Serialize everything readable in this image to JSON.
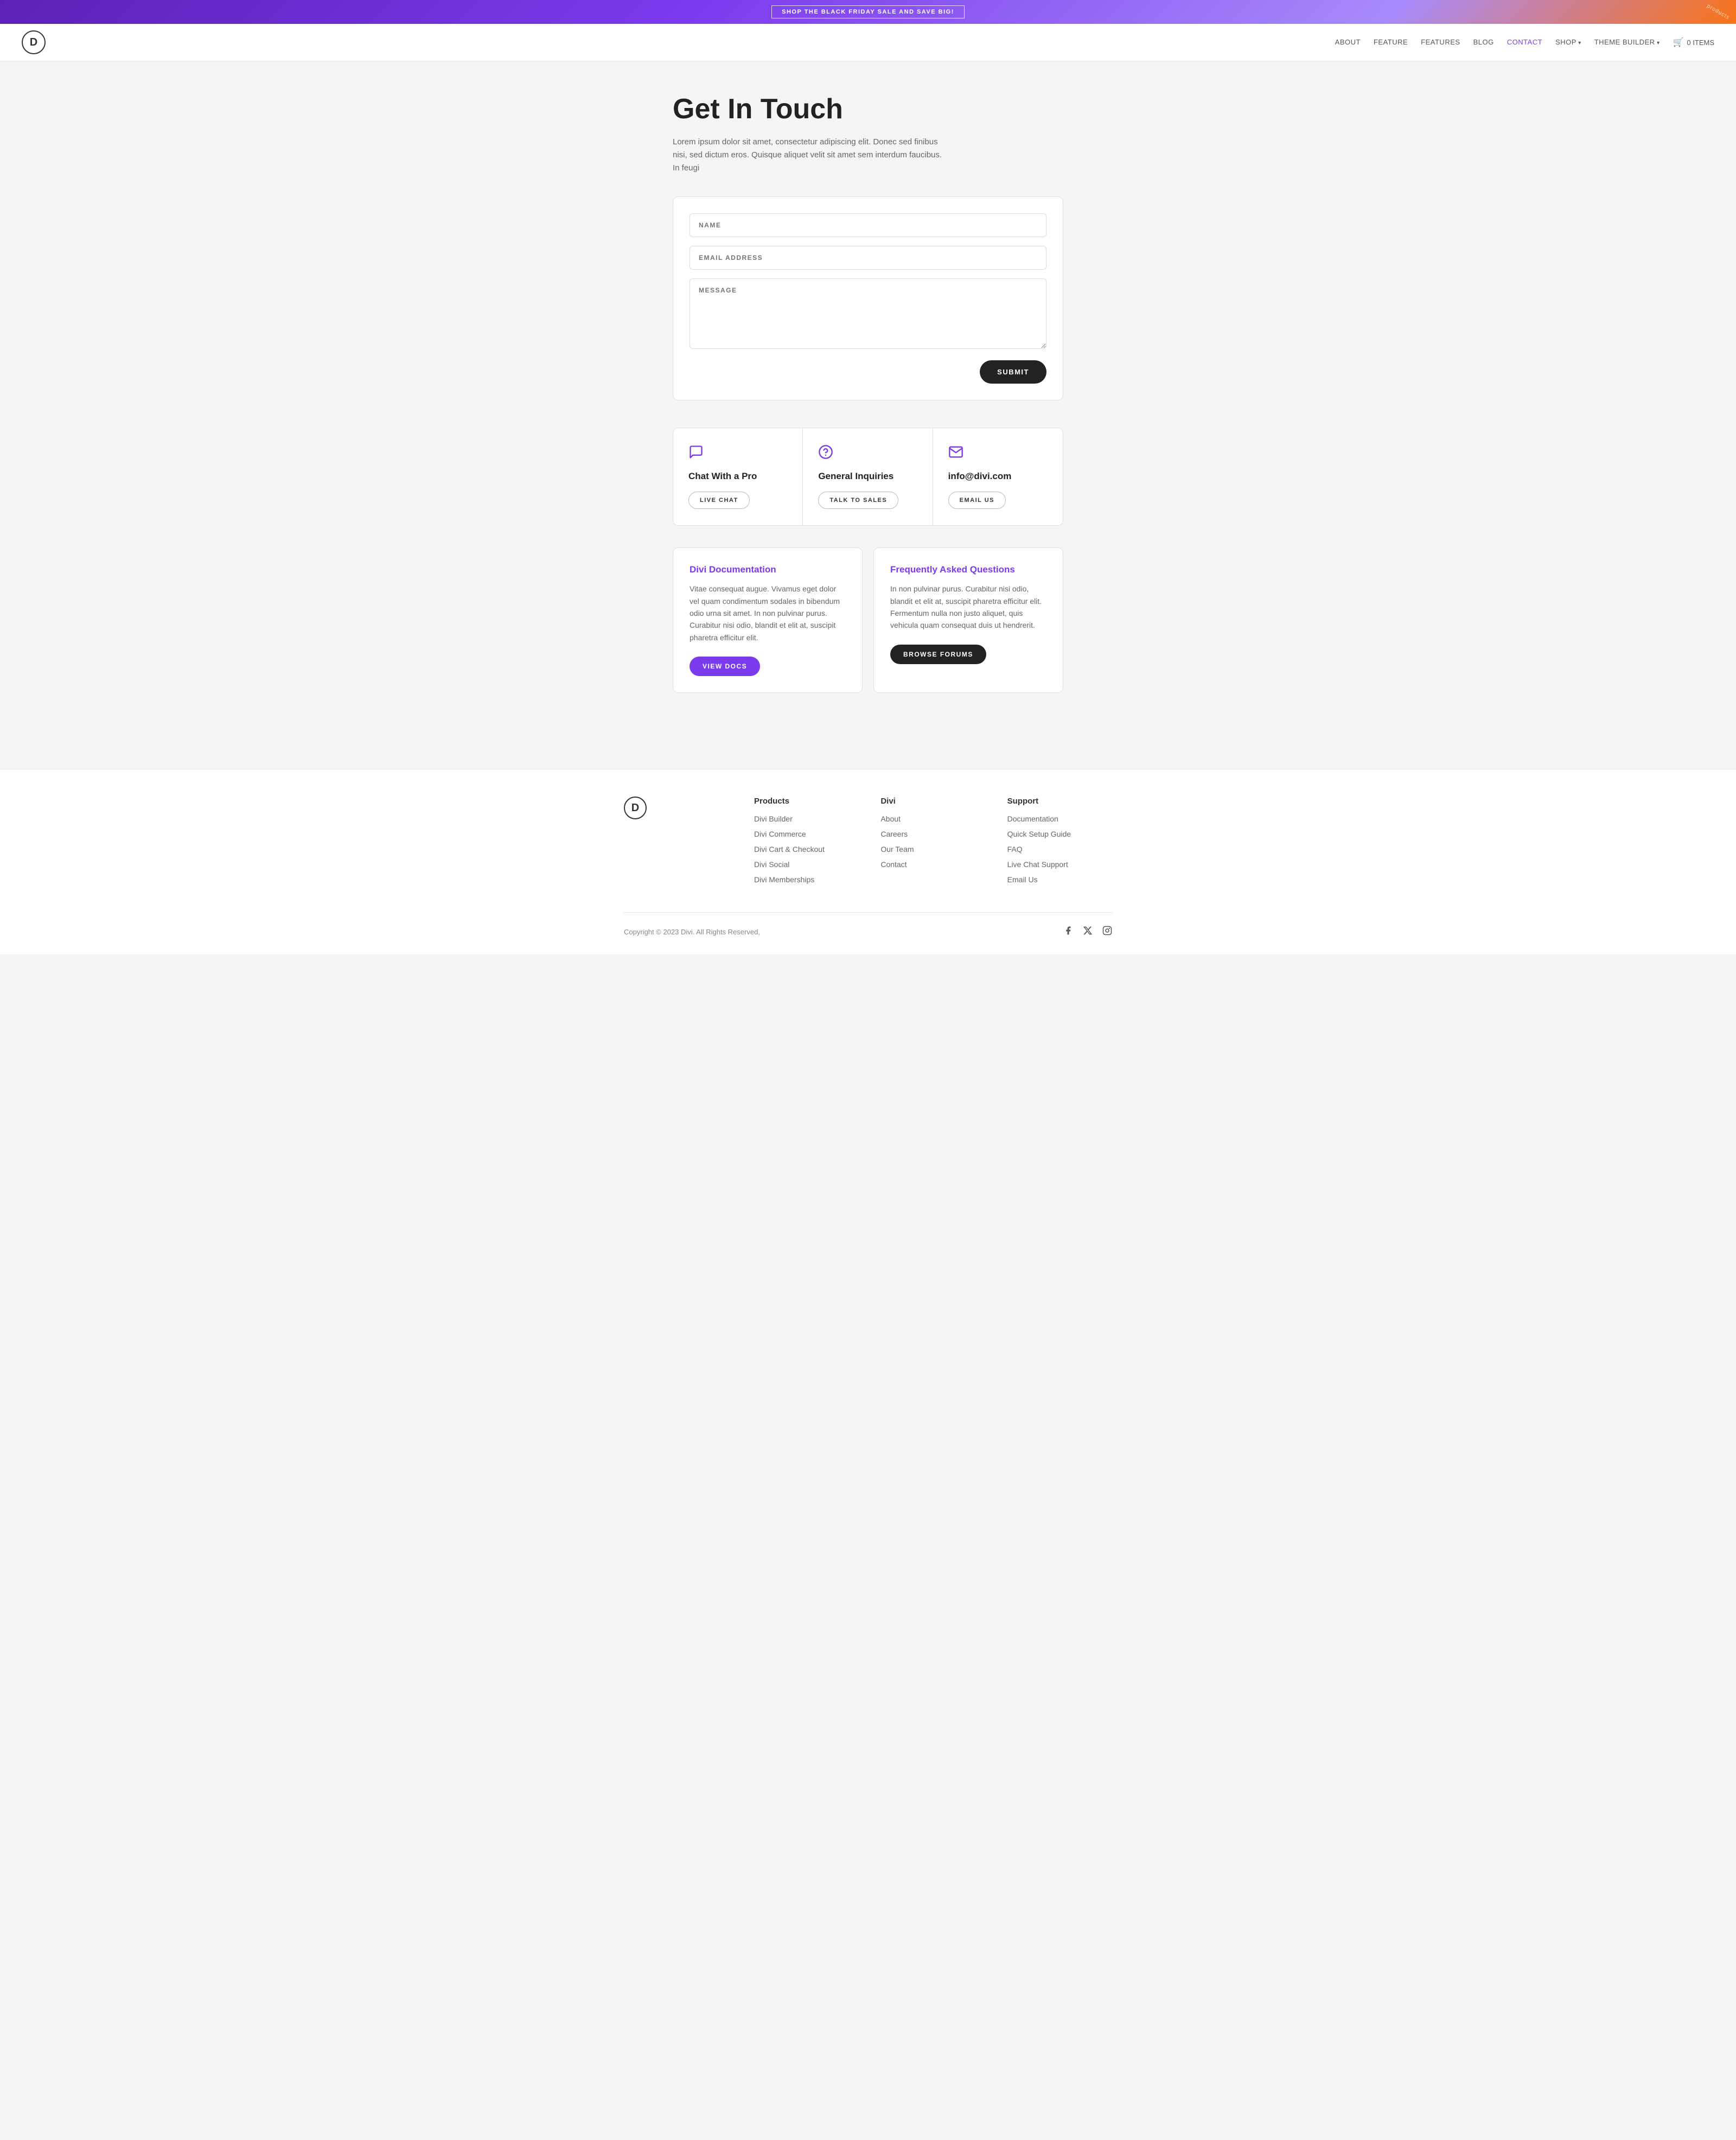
{
  "banner": {
    "cta": "SHOP THE BLACK FRIDAY SALE AND SAVE BIG!",
    "products_label": "products"
  },
  "navbar": {
    "logo_letter": "D",
    "links": [
      {
        "label": "ABOUT",
        "active": false,
        "has_arrow": false
      },
      {
        "label": "FEATURE",
        "active": false,
        "has_arrow": false
      },
      {
        "label": "FEATURES",
        "active": false,
        "has_arrow": false
      },
      {
        "label": "BLOG",
        "active": false,
        "has_arrow": false
      },
      {
        "label": "CONTACT",
        "active": true,
        "has_arrow": false
      },
      {
        "label": "SHOP",
        "active": false,
        "has_arrow": true
      },
      {
        "label": "THEME BUILDER",
        "active": false,
        "has_arrow": true
      }
    ],
    "cart_label": "0 ITEMS"
  },
  "hero": {
    "title": "Get In Touch",
    "subtitle": "Lorem ipsum dolor sit amet, consectetur adipiscing elit. Donec sed finibus nisi, sed dictum eros. Quisque aliquet velit sit amet sem interdum faucibus. In feugi"
  },
  "form": {
    "name_placeholder": "NAME",
    "email_placeholder": "EMAIL ADDRESS",
    "message_placeholder": "MESSAGE",
    "submit_label": "SUBMIT"
  },
  "contact_cards": [
    {
      "icon": "chat",
      "title": "Chat With a Pro",
      "btn_label": "LIVE CHAT"
    },
    {
      "icon": "question",
      "title": "General Inquiries",
      "btn_label": "TALK TO SALES"
    },
    {
      "icon": "email",
      "title": "info@divi.com",
      "btn_label": "EMAIL US"
    }
  ],
  "info_boxes": [
    {
      "title": "Divi Documentation",
      "text": "Vitae consequat augue. Vivamus eget dolor vel quam condimentum sodales in bibendum odio urna sit amet. In non pulvinar purus. Curabitur nisi odio, blandit et elit at, suscipit pharetra efficitur elit.",
      "btn_label": "VIEW DOCS",
      "btn_dark": false
    },
    {
      "title": "Frequently Asked Questions",
      "text": "In non pulvinar purus. Curabitur nisi odio, blandit et elit at, suscipit pharetra efficitur elit. Fermentum nulla non justo aliquet, quis vehicula quam consequat duis ut hendrerit.",
      "btn_label": "BROWSE FORUMS",
      "btn_dark": true
    }
  ],
  "footer": {
    "logo_letter": "D",
    "columns": [
      {
        "title": "Products",
        "links": [
          "Divi Builder",
          "Divi Commerce",
          "Divi Cart & Checkout",
          "Divi Social",
          "Divi Memberships"
        ]
      },
      {
        "title": "Divi",
        "links": [
          "About",
          "Careers",
          "Our Team",
          "Contact"
        ]
      },
      {
        "title": "Support",
        "links": [
          "Documentation",
          "Quick Setup Guide",
          "FAQ",
          "Live Chat Support",
          "Email Us"
        ]
      }
    ],
    "copyright": "Copyright © 2023 Divi. All Rights Reserved,",
    "social": [
      "facebook",
      "x-twitter",
      "instagram"
    ]
  }
}
